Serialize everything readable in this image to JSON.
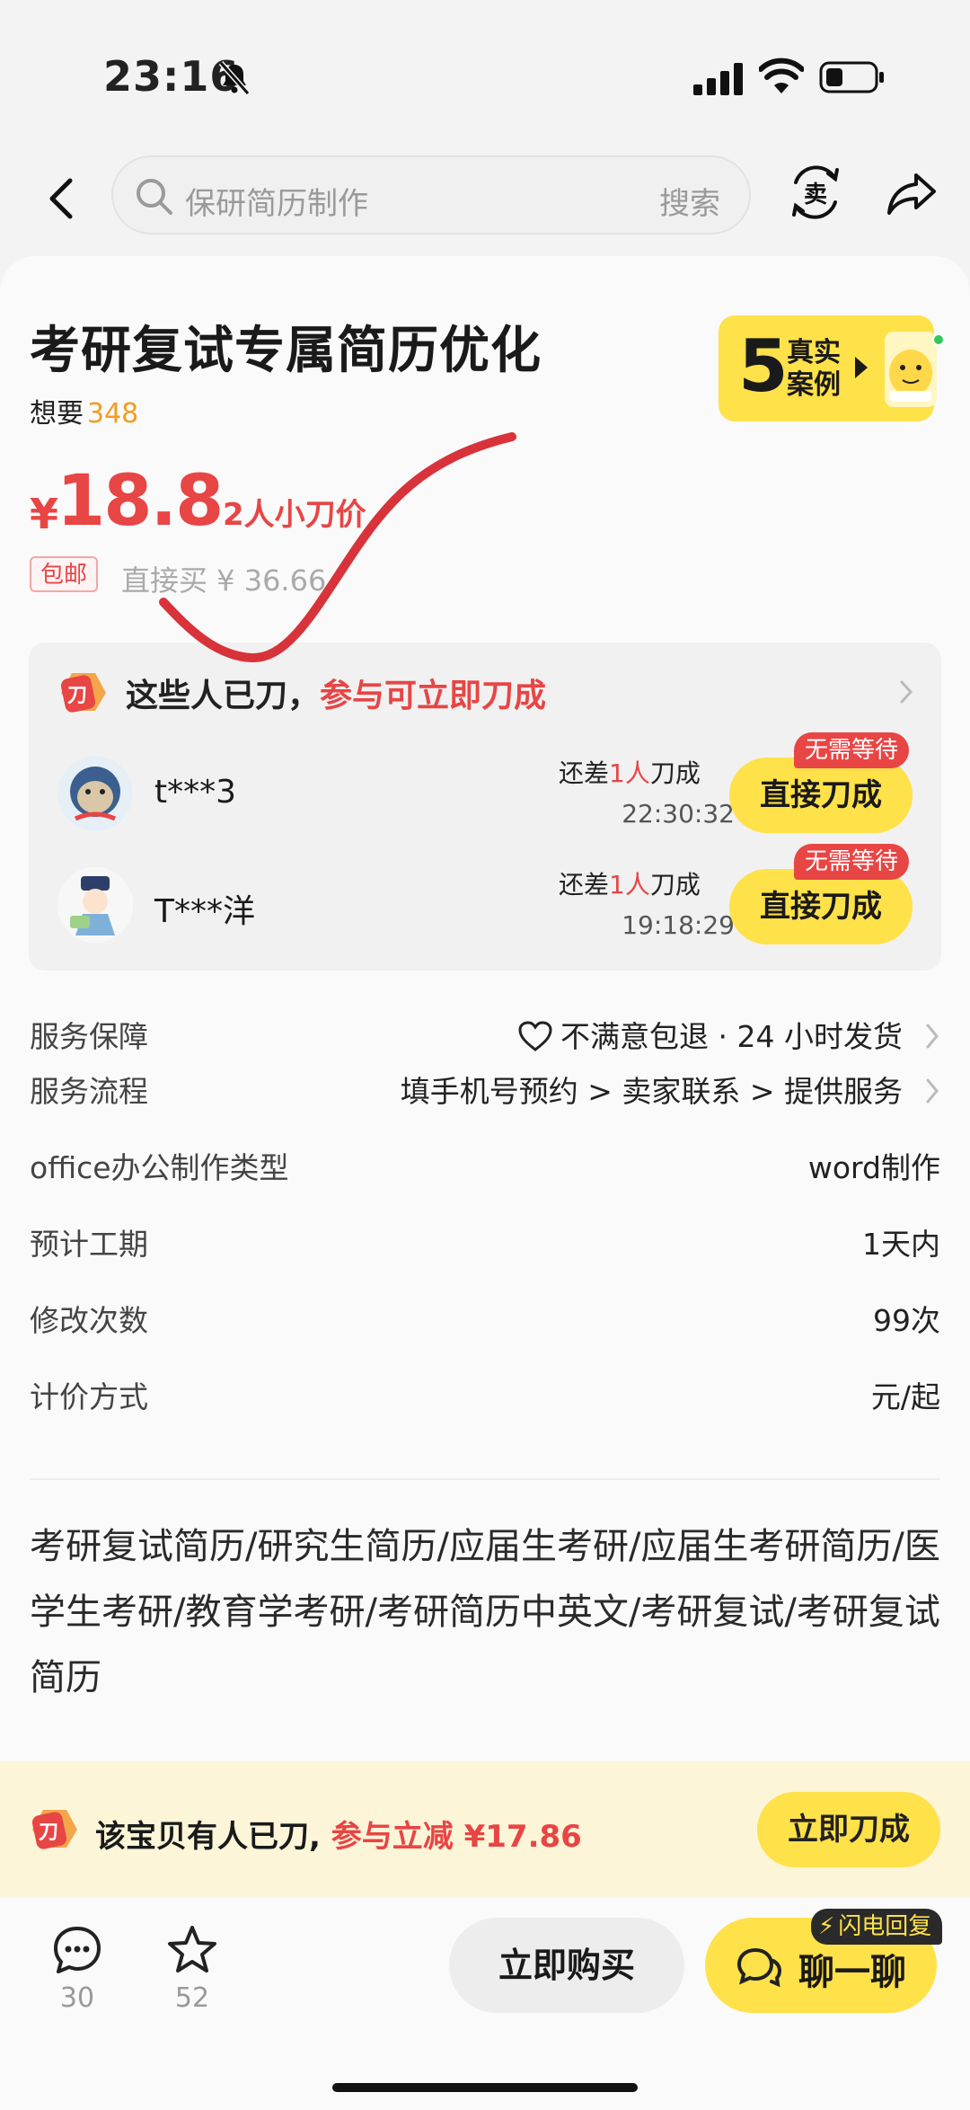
{
  "status_bar": {
    "time": "23:16"
  },
  "nav": {
    "search_placeholder": "保研简历制作",
    "search_button": "搜索"
  },
  "product": {
    "title": "考研复试专属简历优化",
    "want_label": "想要",
    "want_count": "348",
    "case_badge": {
      "number": "5",
      "text": "真实案例"
    },
    "price_symbol": "¥",
    "price": "18.8",
    "price_tag": "2人小刀价",
    "shipping_badge": "包邮",
    "direct_buy": "直接买 ¥ 36.66"
  },
  "bargain": {
    "header_prefix": "这些人已刀，",
    "header_highlight": "参与可立即刀成",
    "rows": [
      {
        "name": "t***3",
        "need_prefix": "还差",
        "need_count": "1人",
        "need_suffix": "刀成",
        "countdown": "22:30:32",
        "badge": "无需等待",
        "button": "直接刀成"
      },
      {
        "name": "T***洋",
        "need_prefix": "还差",
        "need_count": "1人",
        "need_suffix": "刀成",
        "countdown": "19:18:29",
        "badge": "无需等待",
        "button": "直接刀成"
      }
    ]
  },
  "info": [
    {
      "label": "服务保障",
      "value": "不满意包退 · 24 小时发货"
    },
    {
      "label": "服务流程",
      "value": "填手机号预约 > 卖家联系 > 提供服务"
    },
    {
      "label": "office办公制作类型",
      "value": "word制作"
    },
    {
      "label": "预计工期",
      "value": "1天内"
    },
    {
      "label": "修改次数",
      "value": "99次"
    },
    {
      "label": "计价方式",
      "value": "元/起"
    }
  ],
  "tags_text": "考研复试简历/研究生简历/应届生考研/应届生考研简历/医学生考研/教育学考研/考研简历中英文/考研复试/考研复试简历",
  "promo": {
    "prefix": "该宝贝有人已刀,",
    "highlight": " 参与立减 ¥17.86",
    "button": "立即刀成"
  },
  "bottom": {
    "comment_count": "30",
    "favorite_count": "52",
    "buy_button": "立即购买",
    "chat_button": "聊一聊",
    "flash_badge": "闪电回复"
  },
  "colors": {
    "accent_yellow": "#ffe14a",
    "price_red": "#e84545",
    "want_orange": "#f39c1f"
  }
}
